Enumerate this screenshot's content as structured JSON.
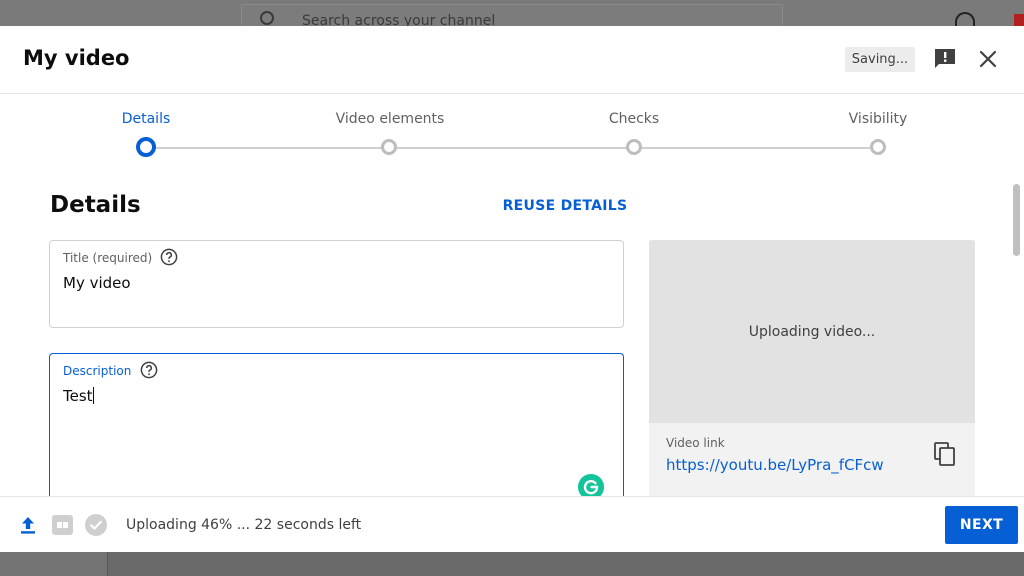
{
  "background": {
    "search_placeholder": "Search across your channel"
  },
  "dialog": {
    "title": "My video",
    "saving_label": "Saving...",
    "icons": {
      "feedback": "feedback-icon",
      "close": "close-icon"
    }
  },
  "stepper": {
    "steps": [
      {
        "label": "Details",
        "active": true
      },
      {
        "label": "Video elements",
        "active": false
      },
      {
        "label": "Checks",
        "active": false
      },
      {
        "label": "Visibility",
        "active": false
      }
    ]
  },
  "details": {
    "section_title": "Details",
    "reuse_label": "REUSE DETAILS",
    "title_field": {
      "label": "Title (required)",
      "value": "My video"
    },
    "description_field": {
      "label": "Description",
      "value": "Test"
    }
  },
  "preview": {
    "status": "Uploading video...",
    "video_link_label": "Video link",
    "video_link": "https://youtu.be/LyPra_fCFcw"
  },
  "footer": {
    "status_text": "Uploading 46% ... 22 seconds left",
    "upload_progress_percent": 46,
    "next_label": "NEXT"
  },
  "colors": {
    "accent": "#065fd4",
    "grammarly": "#15c39a"
  }
}
